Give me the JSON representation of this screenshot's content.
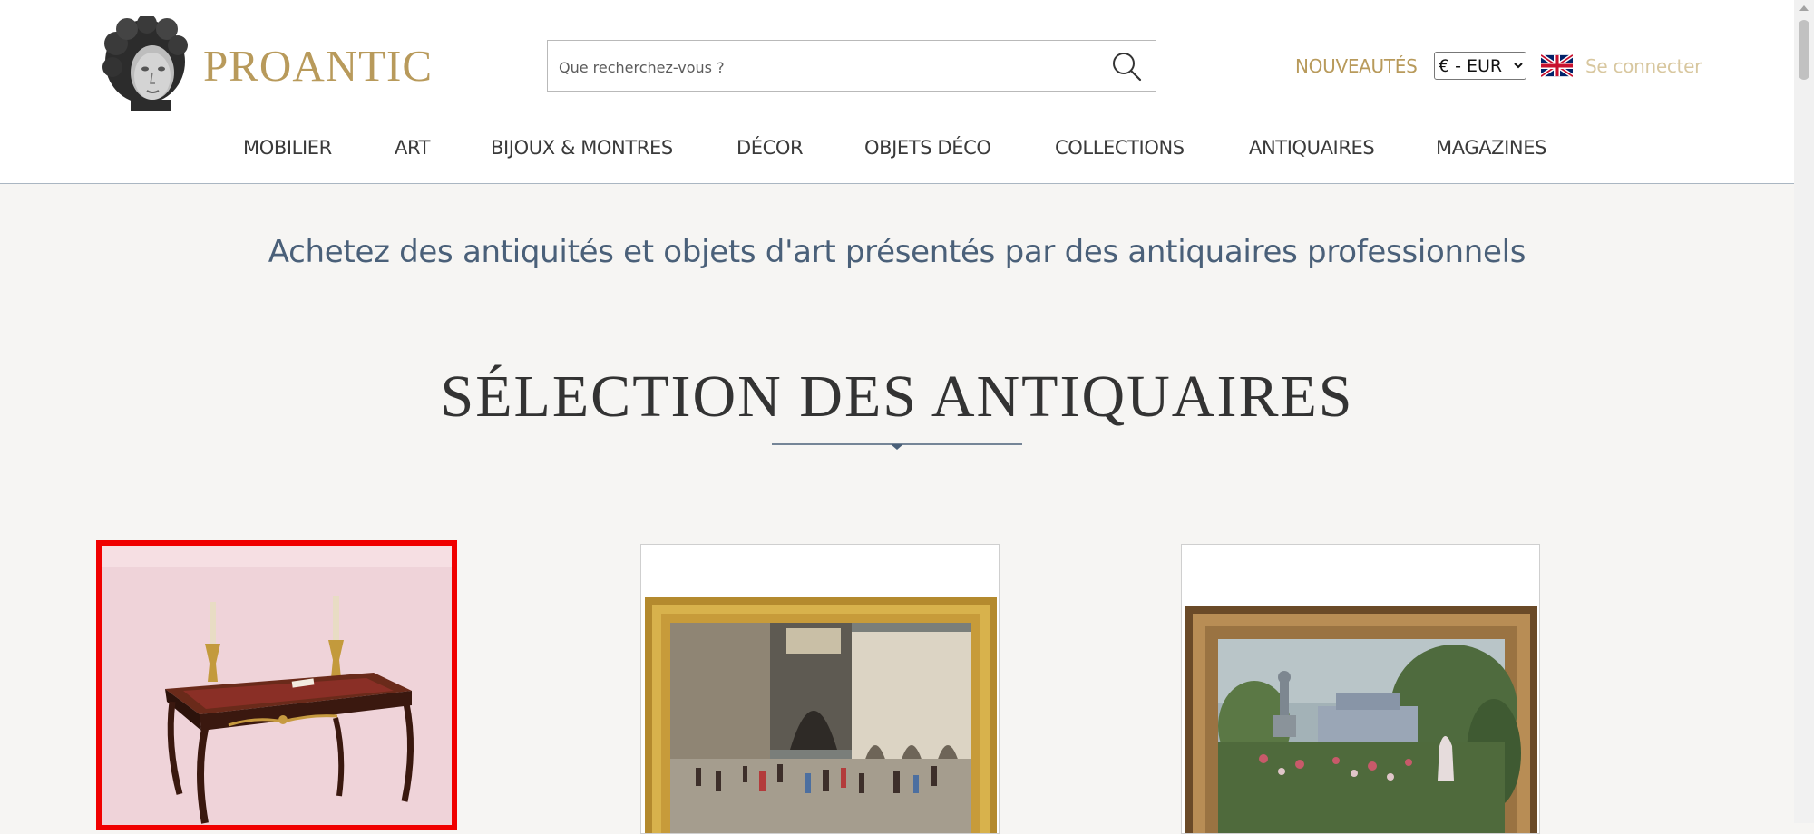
{
  "brand": {
    "name": "PROANTIC"
  },
  "search": {
    "placeholder": "Que recherchez-vous ?"
  },
  "header": {
    "new_label": "NOUVEAUTÉS",
    "currency_selected": "€ - EUR",
    "login_label": "Se connecter"
  },
  "nav": {
    "items": [
      {
        "label": "MOBILIER"
      },
      {
        "label": "ART"
      },
      {
        "label": "BIJOUX & MONTRES"
      },
      {
        "label": "DÉCOR"
      },
      {
        "label": "OBJETS DÉCO"
      },
      {
        "label": "COLLECTIONS"
      },
      {
        "label": "ANTIQUAIRES"
      },
      {
        "label": "MAGAZINES"
      }
    ]
  },
  "main": {
    "tagline": "Achetez des antiquités et objets d'art présentés par des antiquaires professionnels",
    "section_title": "SÉLECTION DES ANTIQUAIRES"
  },
  "products": [
    {
      "image": "louis-xv-writing-desk-with-candlesticks",
      "selected": true
    },
    {
      "image": "venice-piazza-painting-gilt-frame",
      "selected": false
    },
    {
      "image": "garden-statue-landscape-painting-wood-frame",
      "selected": false
    }
  ],
  "colors": {
    "accent_gold": "#b89a5b",
    "login_gold": "#d8c79f",
    "tagline_blue": "#4a6079",
    "selection_red": "#f00000"
  }
}
